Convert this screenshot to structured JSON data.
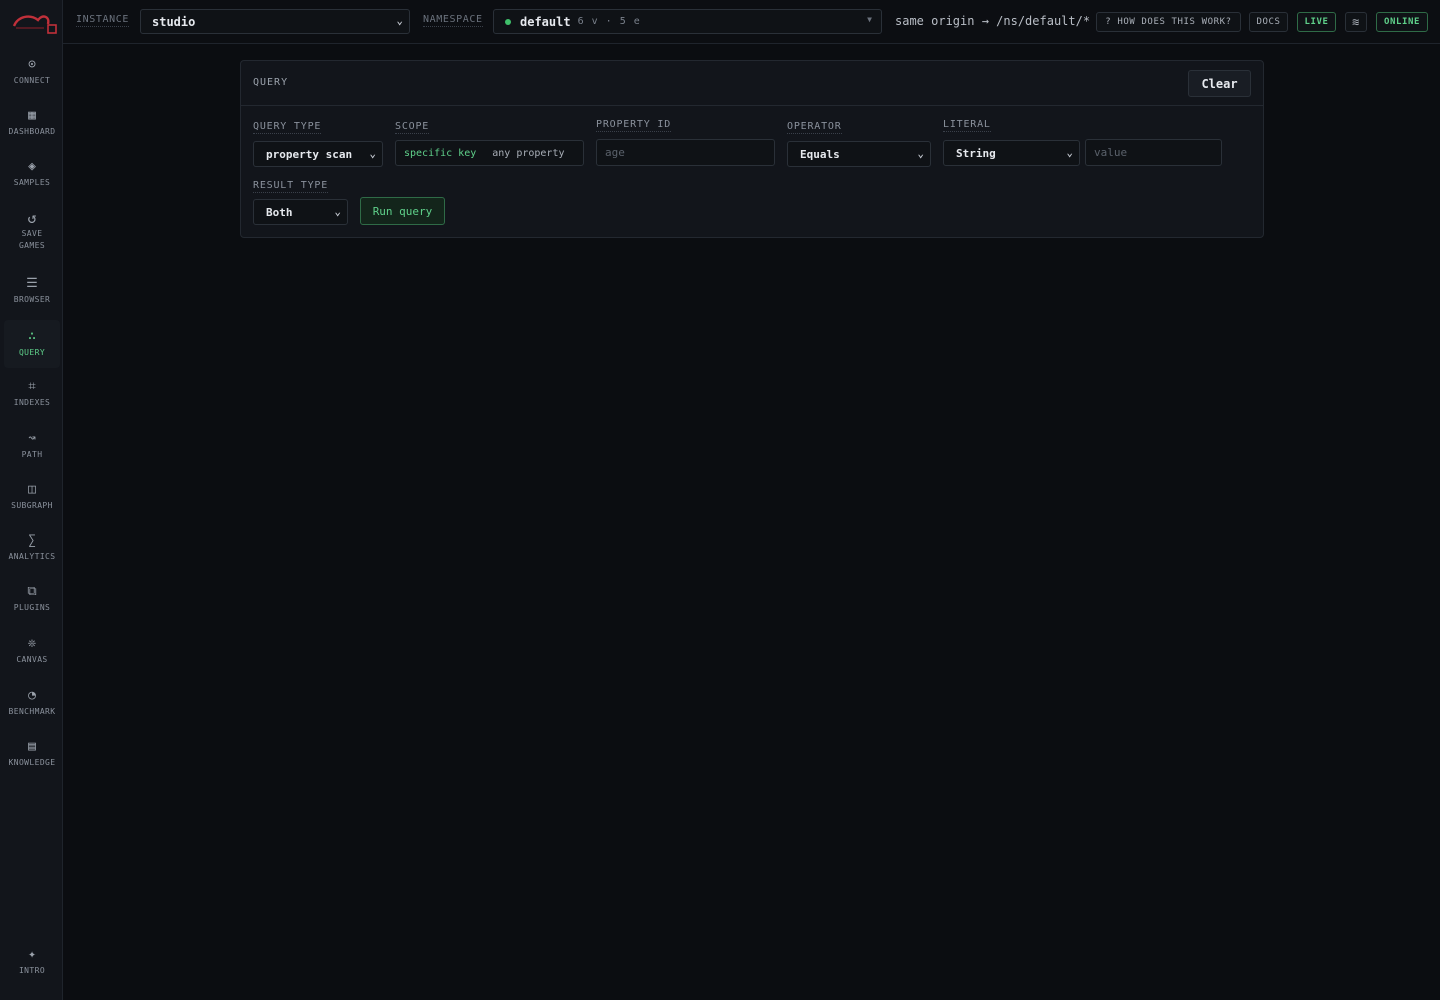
{
  "sidebar": {
    "items": [
      {
        "label": "CONNECT",
        "icon": "⊙"
      },
      {
        "label": "DASHBOARD",
        "icon": "▦"
      },
      {
        "label": "SAMPLES",
        "icon": "◈"
      },
      {
        "label": "SAVE GAMES",
        "icon": "↺"
      },
      {
        "label": "BROWSER",
        "icon": "☰"
      },
      {
        "label": "QUERY",
        "icon": "∴"
      },
      {
        "label": "INDEXES",
        "icon": "⌗"
      },
      {
        "label": "PATH",
        "icon": "↝"
      },
      {
        "label": "SUBGRAPH",
        "icon": "◫"
      },
      {
        "label": "ANALYTICS",
        "icon": "∑"
      },
      {
        "label": "PLUGINS",
        "icon": "⧉"
      },
      {
        "label": "CANVAS",
        "icon": "❊"
      },
      {
        "label": "BENCHMARK",
        "icon": "◔"
      },
      {
        "label": "KNOWLEDGE",
        "icon": "▤"
      }
    ],
    "active": "QUERY",
    "intro": {
      "label": "INTRO",
      "icon": "✦"
    }
  },
  "topbar": {
    "instance_label": "INSTANCE",
    "instance_value": "studio",
    "namespace_label": "NAMESPACE",
    "namespace_value": "default",
    "namespace_meta": "6 v · 5 e",
    "origin_text": "same origin → /ns/default/*",
    "help_label": "? HOW DOES THIS WORK?",
    "docs_label": "DOCS",
    "live_label": "LIVE",
    "theme_icon": "≋",
    "status_label": "ONLINE"
  },
  "query_panel": {
    "title": "QUERY",
    "clear_label": "Clear",
    "query_type_label": "QUERY TYPE",
    "query_type_value": "property scan",
    "scope_label": "SCOPE",
    "scope_options": [
      "specific key",
      "any property"
    ],
    "scope_selected": "specific key",
    "property_id_label": "PROPERTY ID",
    "property_id_placeholder": "age",
    "operator_label": "OPERATOR",
    "operator_value": "Equals",
    "literal_label": "LITERAL",
    "literal_type_value": "String",
    "literal_placeholder": "value",
    "result_type_label": "RESULT TYPE",
    "result_type_value": "Both",
    "run_label": "Run query"
  },
  "colors": {
    "accent": "#5fd08a",
    "background": "#0b0d11",
    "panel": "#12151b",
    "border": "#2a3038",
    "status_dot": "#3fbf6a"
  }
}
